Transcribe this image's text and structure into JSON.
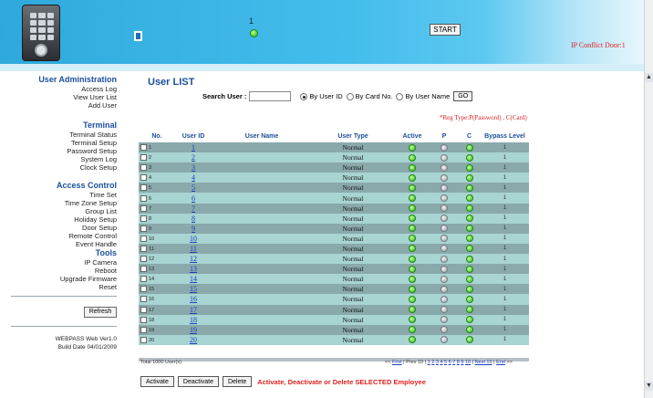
{
  "banner": {
    "door_number": "1",
    "start_label": "START",
    "conflict_text": "IP Conflict Door:1"
  },
  "sidebar": {
    "sections": [
      {
        "title": "User Administration",
        "items": [
          "Access Log",
          "View User List",
          "Add User"
        ]
      },
      {
        "title": "Terminal",
        "items": [
          "Terminal Status",
          "Terminal Setup",
          "Password Setup",
          "System Log",
          "Clock Setup"
        ]
      },
      {
        "title": "Access Control",
        "items": [
          "Time Set",
          "Time Zone Setup",
          "Group List",
          "Holiday Setup",
          "Door Setup",
          "Remote Control",
          "Event Handle"
        ]
      },
      {
        "title": "Tools",
        "items": [
          "IP Camera",
          "Reboot",
          "Upgrade Firmware",
          "Reset"
        ]
      }
    ],
    "refresh_label": "Refresh",
    "version": "WEBPASS Web Ver1.0",
    "build_date": "Build Date 04/01/2009"
  },
  "main": {
    "title": "User LIST",
    "search_label": "Search User :",
    "search_value": "",
    "radio_options": [
      "By User ID",
      "By Card No.",
      "By User Name"
    ],
    "radio_selected": 0,
    "go_label": "GO",
    "reg_type_note": "*Reg Type:P(Password) , C(Card)",
    "columns": [
      "No.",
      "User ID",
      "User Name",
      "User Type",
      "Active",
      "P",
      "C",
      "Bypass Level"
    ],
    "rows": [
      {
        "no": "1",
        "user_id": "1",
        "user_name": "",
        "user_type": "Normal",
        "active": "green",
        "p": "grey",
        "c": "green",
        "bypass": "1"
      },
      {
        "no": "2",
        "user_id": "2",
        "user_name": "",
        "user_type": "Normal",
        "active": "green",
        "p": "grey",
        "c": "green",
        "bypass": "1"
      },
      {
        "no": "3",
        "user_id": "3",
        "user_name": "",
        "user_type": "Normal",
        "active": "green",
        "p": "grey",
        "c": "green",
        "bypass": "1"
      },
      {
        "no": "4",
        "user_id": "4",
        "user_name": "",
        "user_type": "Normal",
        "active": "green",
        "p": "grey",
        "c": "green",
        "bypass": "1"
      },
      {
        "no": "5",
        "user_id": "5",
        "user_name": "",
        "user_type": "Normal",
        "active": "green",
        "p": "grey",
        "c": "green",
        "bypass": "1"
      },
      {
        "no": "6",
        "user_id": "6",
        "user_name": "",
        "user_type": "Normal",
        "active": "green",
        "p": "grey",
        "c": "green",
        "bypass": "1"
      },
      {
        "no": "7",
        "user_id": "7",
        "user_name": "",
        "user_type": "Normal",
        "active": "green",
        "p": "grey",
        "c": "green",
        "bypass": "1"
      },
      {
        "no": "8",
        "user_id": "8",
        "user_name": "",
        "user_type": "Normal",
        "active": "green",
        "p": "grey",
        "c": "green",
        "bypass": "1"
      },
      {
        "no": "9",
        "user_id": "9",
        "user_name": "",
        "user_type": "Normal",
        "active": "green",
        "p": "grey",
        "c": "green",
        "bypass": "1"
      },
      {
        "no": "10",
        "user_id": "10",
        "user_name": "",
        "user_type": "Normal",
        "active": "green",
        "p": "grey",
        "c": "green",
        "bypass": "1"
      },
      {
        "no": "11",
        "user_id": "11",
        "user_name": "",
        "user_type": "Normal",
        "active": "green",
        "p": "grey",
        "c": "green",
        "bypass": "1"
      },
      {
        "no": "12",
        "user_id": "12",
        "user_name": "",
        "user_type": "Normal",
        "active": "green",
        "p": "grey",
        "c": "green",
        "bypass": "1"
      },
      {
        "no": "13",
        "user_id": "13",
        "user_name": "",
        "user_type": "Normal",
        "active": "green",
        "p": "grey",
        "c": "green",
        "bypass": "1"
      },
      {
        "no": "14",
        "user_id": "14",
        "user_name": "",
        "user_type": "Normal",
        "active": "green",
        "p": "grey",
        "c": "green",
        "bypass": "1"
      },
      {
        "no": "15",
        "user_id": "15",
        "user_name": "",
        "user_type": "Normal",
        "active": "green",
        "p": "grey",
        "c": "green",
        "bypass": "1"
      },
      {
        "no": "16",
        "user_id": "16",
        "user_name": "",
        "user_type": "Normal",
        "active": "green",
        "p": "grey",
        "c": "green",
        "bypass": "1"
      },
      {
        "no": "17",
        "user_id": "17",
        "user_name": "",
        "user_type": "Normal",
        "active": "green",
        "p": "grey",
        "c": "green",
        "bypass": "1"
      },
      {
        "no": "18",
        "user_id": "18",
        "user_name": "",
        "user_type": "Normal",
        "active": "green",
        "p": "grey",
        "c": "green",
        "bypass": "1"
      },
      {
        "no": "19",
        "user_id": "19",
        "user_name": "",
        "user_type": "Normal",
        "active": "green",
        "p": "grey",
        "c": "green",
        "bypass": "1"
      },
      {
        "no": "20",
        "user_id": "20",
        "user_name": "",
        "user_type": "Normal",
        "active": "green",
        "p": "grey",
        "c": "green",
        "bypass": "1"
      }
    ],
    "total_text": "Total 1000 User(s)",
    "pager": {
      "first": "First",
      "prev": "Prev 10",
      "pages": [
        "1",
        "2",
        "3",
        "4",
        "5",
        "6",
        "7",
        "8",
        "9",
        "10"
      ],
      "next": "Next 10",
      "end": "End"
    },
    "activate_label": "Activate",
    "deactivate_label": "Deactivate",
    "delete_label": "Delete",
    "action_message": "Activate, Deactivate or Delete SELECTED Employee"
  },
  "colors": {
    "heading_blue": "#1b4f9c",
    "alert_red": "#dd2222",
    "row_dark": "#8aa9ab",
    "row_light": "#a8d4d2"
  }
}
